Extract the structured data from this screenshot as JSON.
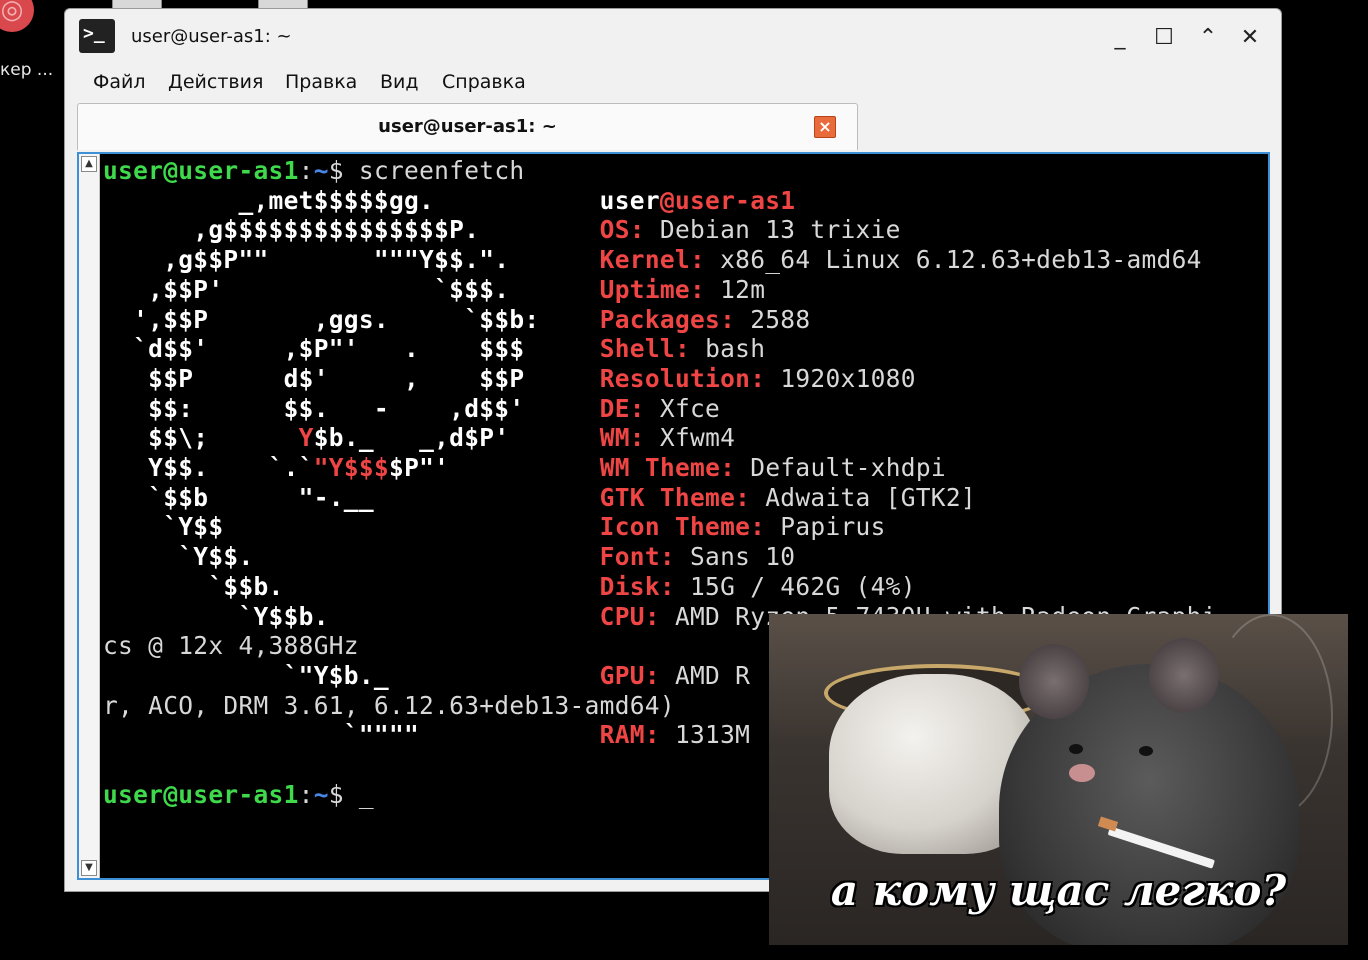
{
  "desktop": {
    "icon_label": "кер ..."
  },
  "window": {
    "title": "user@user-as1: ~",
    "controls": {
      "minimize": "_",
      "maximize": "☐",
      "shade": "⌃",
      "close": "✕"
    }
  },
  "menubar": [
    "Файл",
    "Действия",
    "Правка",
    "Вид",
    "Справка"
  ],
  "tab": {
    "title": "user@user-as1: ~",
    "close": "×"
  },
  "terminal": {
    "prompt_user": "user@user-as1",
    "prompt_path": "~",
    "prompt_sign": "$",
    "command": "screenfetch",
    "logo": [
      "         _,met$$$$$gg.",
      "      ,g$$$$$$$$$$$$$$$P.",
      "    ,g$$P\"\"       \"\"\"Y$$.\".",
      "   ,$$P'              `$$$.",
      "  ',$$P       ,ggs.     `$$b:",
      "  `d$$'     ,$P\"'   .    $$$",
      "   $$P      d$'     ,    $$P",
      "   $$:      $$.   -    ,d$$'",
      "   $$\\;      Y$b._   _,d$P'",
      "   Y$$.    `.`\"Y$$$$P\"'",
      "   `$$b      \"-.__",
      "    `Y$$",
      "     `Y$$.",
      "       `$$b.",
      "         `Y$$b.",
      "            `\"Y$b._",
      "                `\"\"\"\""
    ],
    "info_user": "user",
    "info_at": "@",
    "info_host": "user-as1",
    "info": [
      {
        "key": "OS:",
        "value": "Debian 13 trixie"
      },
      {
        "key": "Kernel:",
        "value": "x86_64 Linux 6.12.63+deb13-amd64"
      },
      {
        "key": "Uptime:",
        "value": "12m"
      },
      {
        "key": "Packages:",
        "value": "2588"
      },
      {
        "key": "Shell:",
        "value": "bash"
      },
      {
        "key": "Resolution:",
        "value": "1920x1080"
      },
      {
        "key": "DE:",
        "value": "Xfce"
      },
      {
        "key": "WM:",
        "value": "Xfwm4"
      },
      {
        "key": "WM Theme:",
        "value": "Default-xhdpi"
      },
      {
        "key": "GTK Theme:",
        "value": "Adwaita [GTK2]"
      },
      {
        "key": "Icon Theme:",
        "value": "Papirus"
      },
      {
        "key": "Font:",
        "value": "Sans 10"
      },
      {
        "key": "Disk:",
        "value": "15G / 462G (4%)"
      },
      {
        "key": "CPU:",
        "value": "AMD Ryzen 5 7430U with Radeon Graphi"
      },
      {
        "key": "GPU:",
        "value": "AMD R"
      },
      {
        "key": "RAM:",
        "value": "1313M"
      }
    ],
    "wrap_cpu": "cs @ 12x 4,388GHz",
    "wrap_gpu": "r, ACO, DRM 3.61, 6.12.63+deb13-amd64)",
    "cursor": "_"
  },
  "meme": {
    "caption": "а кому щас легко?"
  }
}
